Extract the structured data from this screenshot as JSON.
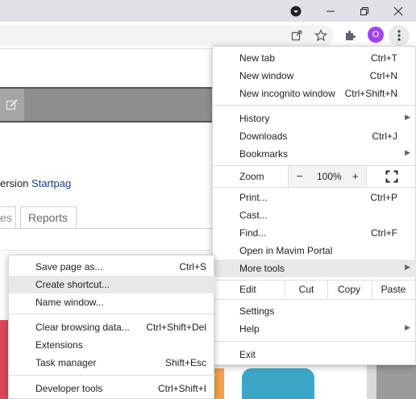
{
  "window": {
    "minimize_icon": "minimize-icon",
    "restore_icon": "restore-icon",
    "close_icon": "close-icon"
  },
  "toolbar": {
    "profile_initial": "O"
  },
  "page": {
    "partial_text_prefix": "ersion ",
    "link_text": "Startpag",
    "tab_partial": "es",
    "tab_reports": "Reports"
  },
  "menu": {
    "items": [
      {
        "label": "New tab",
        "shortcut": "Ctrl+T"
      },
      {
        "label": "New window",
        "shortcut": "Ctrl+N"
      },
      {
        "label": "New incognito window",
        "shortcut": "Ctrl+Shift+N"
      },
      {
        "label": "History",
        "shortcut": ""
      },
      {
        "label": "Downloads",
        "shortcut": "Ctrl+J"
      },
      {
        "label": "Bookmarks",
        "shortcut": ""
      },
      {
        "label": "Print...",
        "shortcut": "Ctrl+P"
      },
      {
        "label": "Cast...",
        "shortcut": ""
      },
      {
        "label": "Find...",
        "shortcut": "Ctrl+F"
      },
      {
        "label": "Open in Mavim Portal",
        "shortcut": ""
      },
      {
        "label": "More tools",
        "shortcut": ""
      },
      {
        "label": "Settings",
        "shortcut": ""
      },
      {
        "label": "Help",
        "shortcut": ""
      },
      {
        "label": "Exit",
        "shortcut": ""
      }
    ],
    "zoom": {
      "label": "Zoom",
      "minus": "−",
      "value": "100%",
      "plus": "+"
    },
    "edit": {
      "label": "Edit",
      "cut": "Cut",
      "copy": "Copy",
      "paste": "Paste"
    }
  },
  "submenu": {
    "items": [
      {
        "label": "Save page as...",
        "shortcut": "Ctrl+S"
      },
      {
        "label": "Create shortcut...",
        "shortcut": ""
      },
      {
        "label": "Name window...",
        "shortcut": ""
      },
      {
        "label": "Clear browsing data...",
        "shortcut": "Ctrl+Shift+Del"
      },
      {
        "label": "Extensions",
        "shortcut": ""
      },
      {
        "label": "Task manager",
        "shortcut": "Shift+Esc"
      },
      {
        "label": "Developer tools",
        "shortcut": "Ctrl+Shift+I"
      }
    ]
  }
}
